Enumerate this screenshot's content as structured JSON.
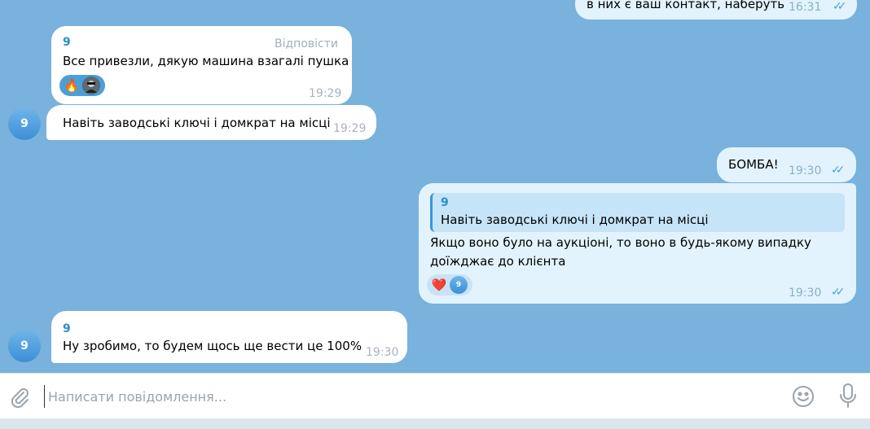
{
  "messages": {
    "m0": {
      "text": "в них є ваш контакт, наберуть",
      "time": "16:31"
    },
    "m1": {
      "sender": "9",
      "reply_label": "Відповісти",
      "text": "Все привезли, дякую машина взагалі пушка",
      "reaction_emoji": "🔥",
      "time": "19:29"
    },
    "m2": {
      "text": "Навіть заводські ключі і домкрат на місці",
      "time": "19:29",
      "avatar": "9"
    },
    "m3": {
      "text": "БОМБА!",
      "time": "19:30"
    },
    "m4": {
      "quote_sender": "9",
      "quote_text": "Навіть заводські ключі і домкрат на місці",
      "text_line1": "Якщо воно було на аукціоні,  то воно в будь-якому випадку",
      "text_line2": "доїжджає до клієнта",
      "reaction_emoji": "❤️",
      "reaction_avatar": "9",
      "time": "19:30"
    },
    "m5": {
      "sender": "9",
      "text": "Ну зробимо, то будем щось ще вести це 100%",
      "time": "19:30",
      "avatar": "9"
    }
  },
  "composer": {
    "placeholder": "Написати повідомлення..."
  },
  "colors": {
    "chat_bg": "#78b2dd",
    "incoming": "#ffffff",
    "outgoing": "#e2f3fd",
    "accent": "#2a8fc9",
    "checks": "#4b9fd6"
  }
}
